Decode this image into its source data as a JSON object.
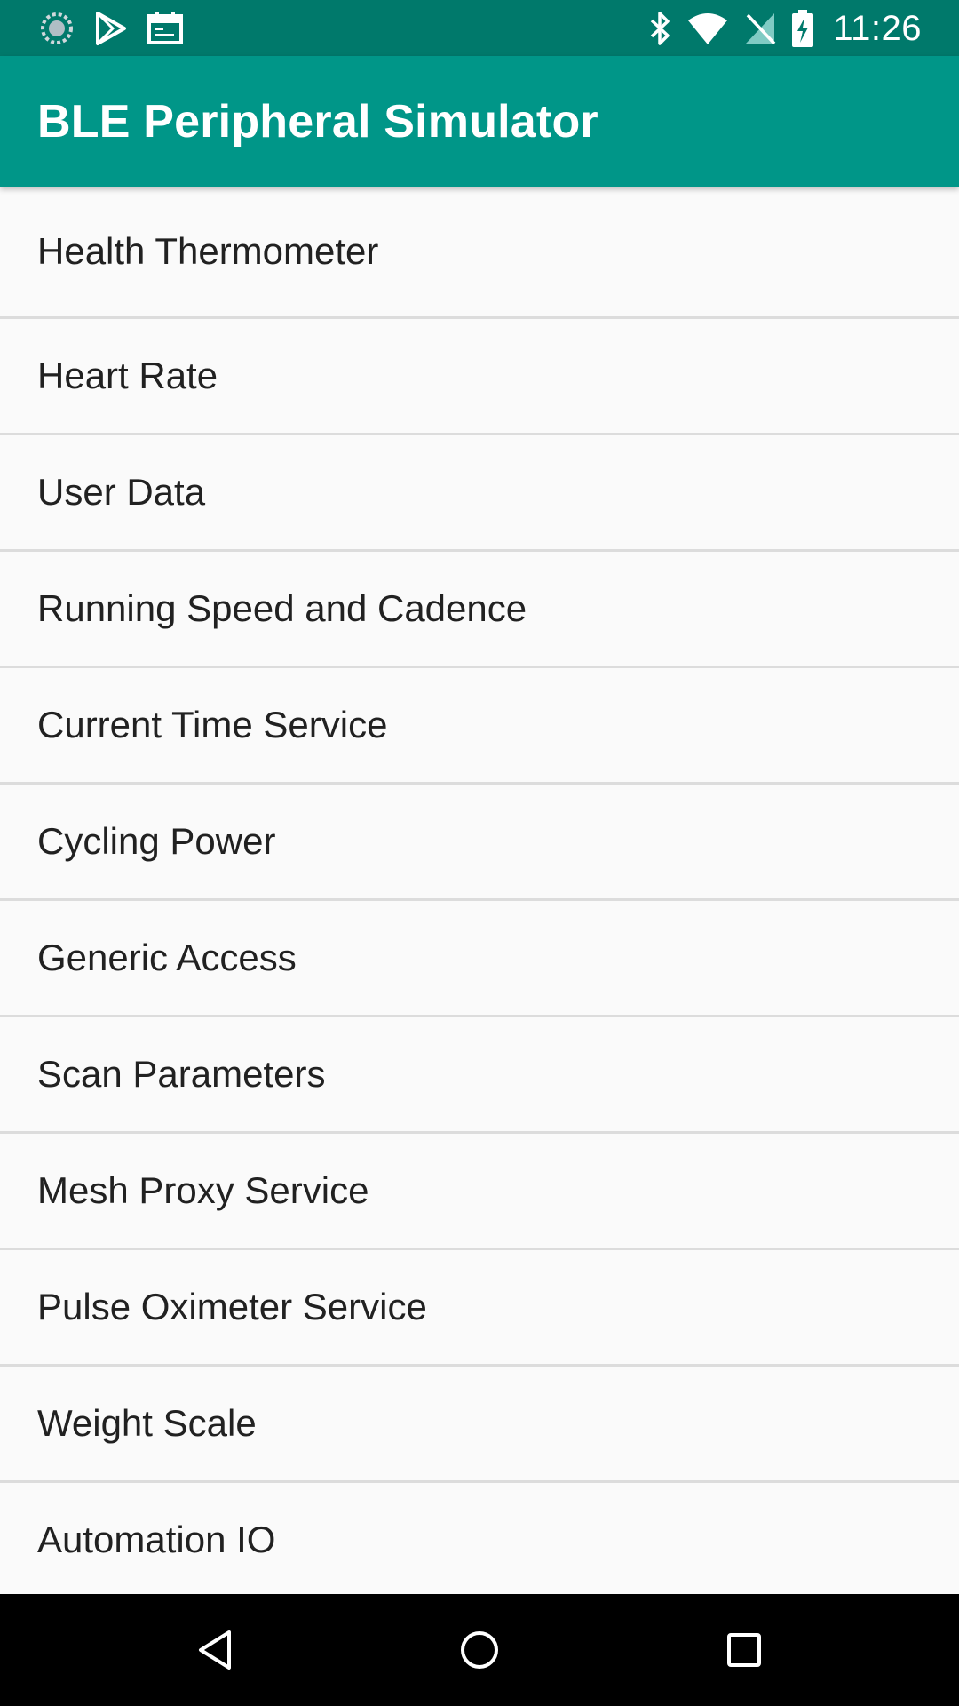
{
  "status_bar": {
    "time": "11:26",
    "left_icons": [
      "sync-icon",
      "play-store-icon",
      "calendar-icon"
    ],
    "right_icons": [
      "bluetooth-icon",
      "wifi-icon",
      "no-signal-icon",
      "battery-charging-icon"
    ]
  },
  "app_bar": {
    "title": "BLE Peripheral Simulator",
    "background": "#009688"
  },
  "services": [
    "Health Thermometer",
    "Heart Rate",
    "User Data",
    "Running Speed and Cadence",
    "Current Time Service",
    "Cycling Power",
    "Generic Access",
    "Scan Parameters",
    "Mesh Proxy Service",
    "Pulse Oximeter Service",
    "Weight Scale",
    "Automation IO"
  ],
  "nav_bar": {
    "buttons": [
      "back-icon",
      "home-icon",
      "recents-icon"
    ]
  }
}
